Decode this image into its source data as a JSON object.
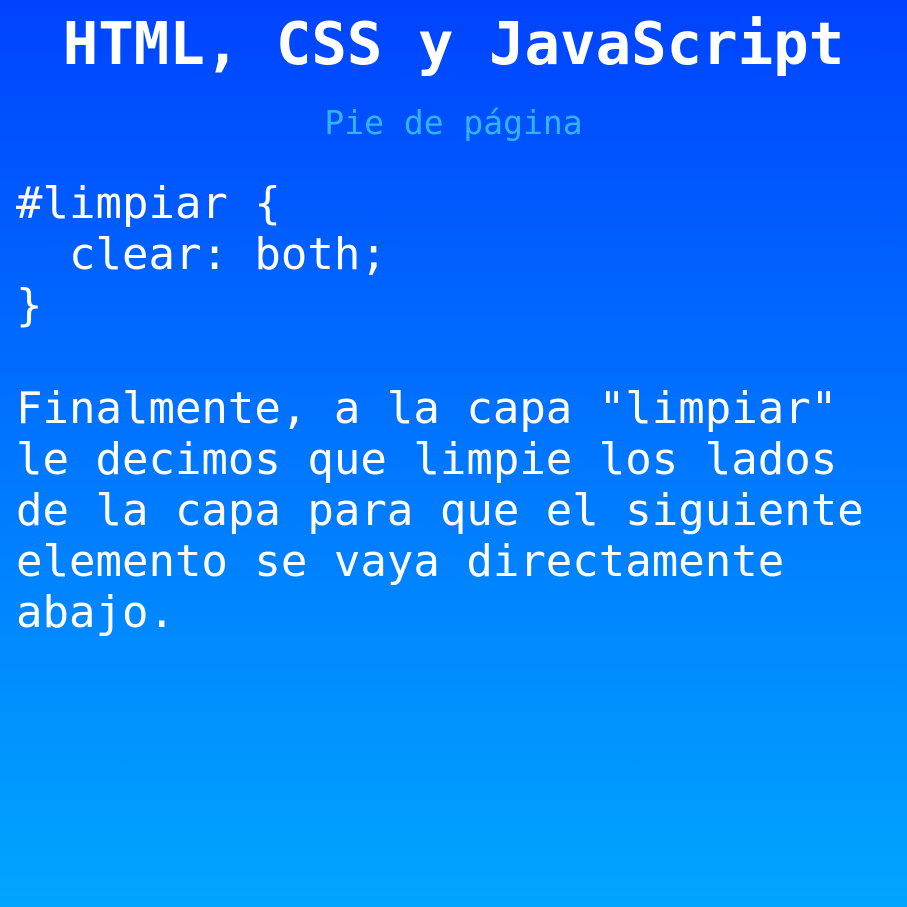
{
  "slide": {
    "title": "HTML, CSS y JavaScript",
    "subtitle": "Pie de página",
    "code_lines": [
      "#limpiar {",
      "  clear: both;",
      "}"
    ],
    "paragraph_lines": [
      "Finalmente, a la capa \"limpiar\"",
      "le decimos que limpie los lados",
      "de la capa para que el siguiente",
      "elemento se vaya directamente",
      "abajo."
    ],
    "colors": {
      "gradient_top": "#0043ff",
      "gradient_bottom": "#00a6ff",
      "subtitle": "#33b3ff",
      "text": "#ffffff"
    }
  }
}
